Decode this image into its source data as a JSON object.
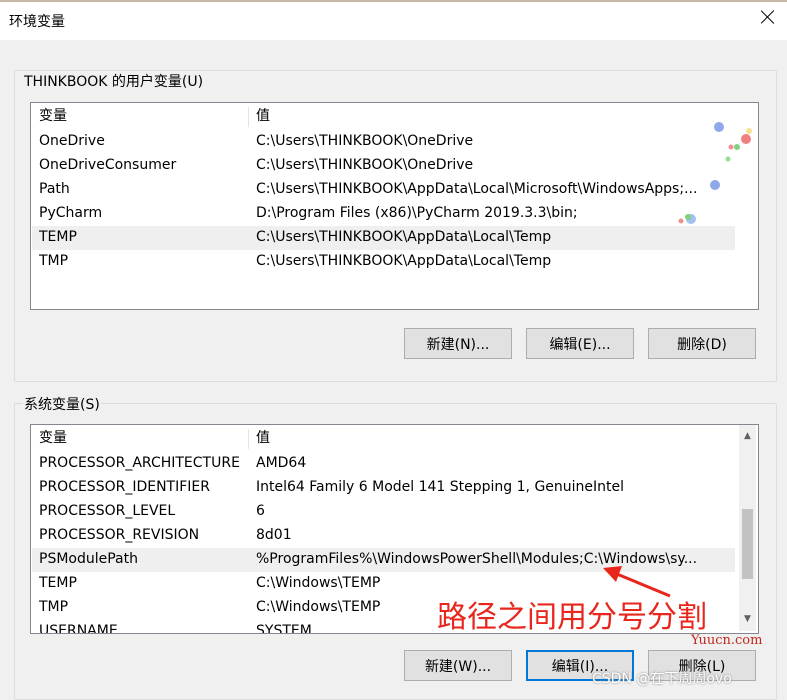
{
  "window": {
    "title": "环境变量"
  },
  "user_vars": {
    "group_label": "THINKBOOK 的用户变量(U)",
    "columns": [
      "变量",
      "值"
    ],
    "rows": [
      {
        "name": "OneDrive",
        "value": "C:\\Users\\THINKBOOK\\OneDrive"
      },
      {
        "name": "OneDriveConsumer",
        "value": "C:\\Users\\THINKBOOK\\OneDrive"
      },
      {
        "name": "Path",
        "value": "C:\\Users\\THINKBOOK\\AppData\\Local\\Microsoft\\WindowsApps;..."
      },
      {
        "name": "PyCharm",
        "value": "D:\\Program Files (x86)\\PyCharm 2019.3.3\\bin;"
      },
      {
        "name": "TEMP",
        "value": "C:\\Users\\THINKBOOK\\AppData\\Local\\Temp"
      },
      {
        "name": "TMP",
        "value": "C:\\Users\\THINKBOOK\\AppData\\Local\\Temp"
      }
    ],
    "selected_row": 4,
    "buttons": {
      "new": "新建(N)...",
      "edit": "编辑(E)...",
      "delete": "删除(D)"
    }
  },
  "system_vars": {
    "group_label": "系统变量(S)",
    "columns": [
      "变量",
      "值"
    ],
    "rows": [
      {
        "name": "PROCESSOR_ARCHITECTURE",
        "value": "AMD64"
      },
      {
        "name": "PROCESSOR_IDENTIFIER",
        "value": "Intel64 Family 6 Model 141 Stepping 1, GenuineIntel"
      },
      {
        "name": "PROCESSOR_LEVEL",
        "value": "6"
      },
      {
        "name": "PROCESSOR_REVISION",
        "value": "8d01"
      },
      {
        "name": "PSModulePath",
        "value": "%ProgramFiles%\\WindowsPowerShell\\Modules;C:\\Windows\\sy..."
      },
      {
        "name": "TEMP",
        "value": "C:\\Windows\\TEMP"
      },
      {
        "name": "TMP",
        "value": "C:\\Windows\\TEMP"
      },
      {
        "name": "USERNAME",
        "value": "SYSTEM"
      }
    ],
    "selected_row": 4,
    "buttons": {
      "new": "新建(W)...",
      "edit": "编辑(I)...",
      "delete": "删除(L)"
    }
  },
  "annotation": {
    "text": "路径之间用分号分割",
    "color": "#e8261c"
  },
  "watermarks": {
    "site": "Yuucn.com",
    "csdn": "CSDN @在下周周ovo"
  },
  "colors": {
    "focus_border": "#0078d7",
    "selection": "#efefef"
  }
}
